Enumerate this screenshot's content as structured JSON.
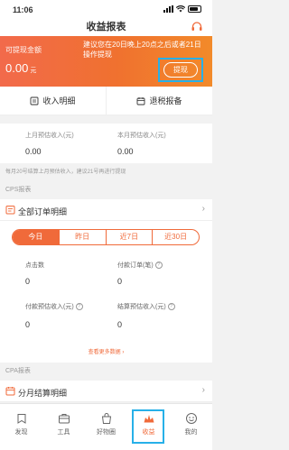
{
  "status": {
    "time": "11:06"
  },
  "header": {
    "title": "收益报表"
  },
  "banner": {
    "withdrawable_label": "可提现金额",
    "amount": "0.00",
    "amount_unit": "元",
    "tip": "建议您在20日晚上20点之后或者21日操作提现",
    "withdraw_button": "提现"
  },
  "shortcuts": [
    {
      "label": "收入明细",
      "icon": "receipt-icon"
    },
    {
      "label": "退税报备",
      "icon": "tax-icon"
    }
  ],
  "estimate": {
    "last_month_label": "上月预估收入(元)",
    "last_month_value": "0.00",
    "this_month_label": "本月预估收入(元)",
    "this_month_value": "0.00",
    "note": "每月20号结算上月预估收入，建议21号再进行提现"
  },
  "cps": {
    "section_title": "CPS报表",
    "all_orders_label": "全部订单明细",
    "ranges": [
      "今日",
      "昨日",
      "近7日",
      "近30日"
    ],
    "selected_range": "今日",
    "metrics": {
      "clicks_label": "点击数",
      "clicks_value": "0",
      "paid_orders_label": "付款订单(笔)",
      "paid_orders_value": "0",
      "paid_est_label": "付款预估收入(元)",
      "paid_est_value": "0",
      "settled_est_label": "结算预估收入(元)",
      "settled_est_value": "0"
    },
    "more_label": "查看更多数据"
  },
  "cpa": {
    "section_title": "CPA报表",
    "settlement_label": "分月结算明细"
  },
  "tabbar": [
    {
      "label": "发现",
      "icon": "discover-icon"
    },
    {
      "label": "工具",
      "icon": "toolbox-icon"
    },
    {
      "label": "好物圈",
      "icon": "bag-icon"
    },
    {
      "label": "收益",
      "icon": "earnings-icon"
    },
    {
      "label": "我的",
      "icon": "profile-icon"
    }
  ],
  "active_tab": "收益",
  "colors": {
    "accent": "#f06a3a",
    "highlight": "#27b0e8"
  }
}
